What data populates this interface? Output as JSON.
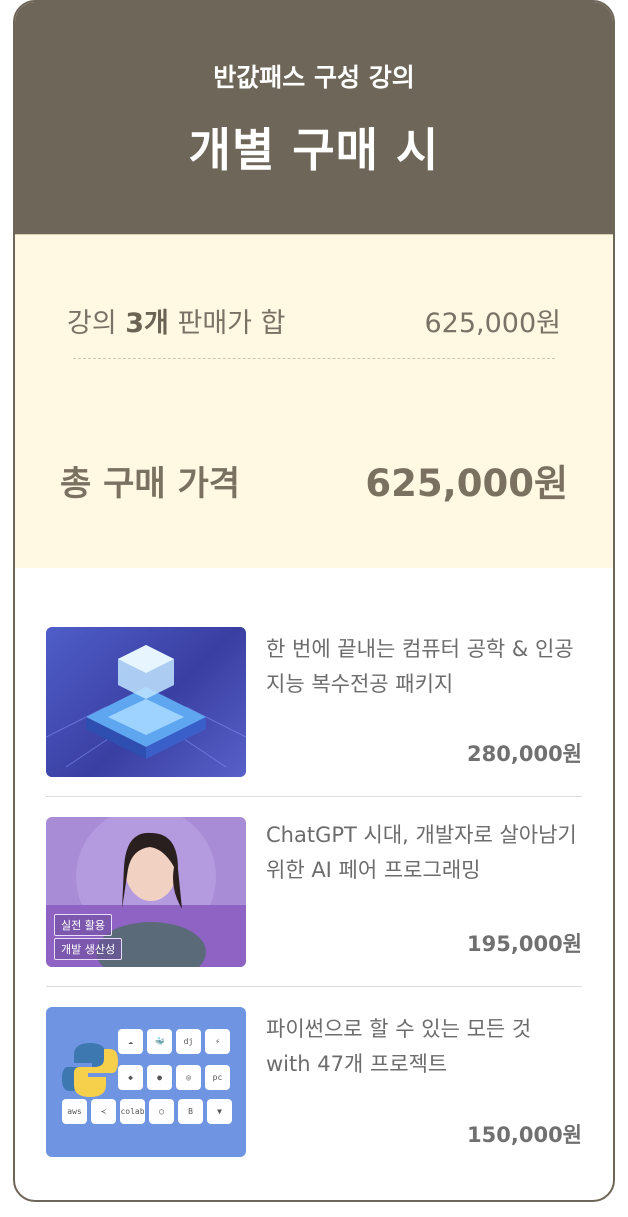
{
  "header": {
    "subtitle": "반값패스 구성 강의",
    "title": "개별 구매 시"
  },
  "summary": {
    "label_prefix": "강의 ",
    "label_count": "3개",
    "label_suffix": " 판매가 합",
    "sum_value": "625,000원",
    "total_label": "총 구매 가격",
    "total_value": "625,000원"
  },
  "courses": [
    {
      "title": "한 번에 끝내는 컴퓨터 공학 & 인공지능 복수전공 패키지",
      "price": "280,000원"
    },
    {
      "title": "ChatGPT 시대, 개발자로 살아남기 위한 AI 페어 프로그래밍",
      "price": "195,000원",
      "tags": [
        "실전 활용",
        "개발 생산성"
      ]
    },
    {
      "title": "파이썬으로 할 수 있는 모든 것 with 47개 프로젝트",
      "price": "150,000원",
      "tiles": [
        "aws",
        "colab",
        "pc",
        "dj",
        "B"
      ]
    }
  ],
  "colors": {
    "header_bg": "#6e6658",
    "summary_bg": "#fff8e3",
    "accent_text": "#7a7160"
  }
}
